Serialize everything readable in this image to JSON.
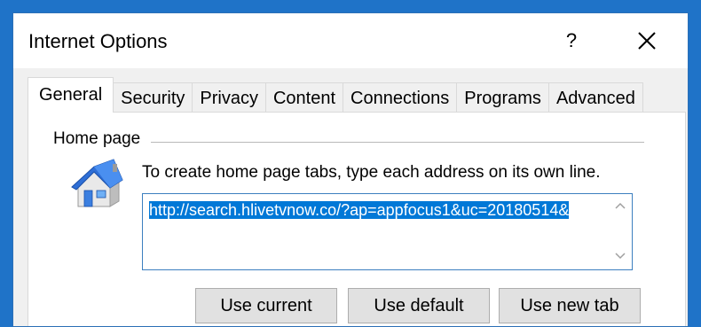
{
  "window": {
    "title": "Internet Options",
    "help_label": "?"
  },
  "tabs": [
    {
      "label": "General",
      "active": true
    },
    {
      "label": "Security",
      "active": false
    },
    {
      "label": "Privacy",
      "active": false
    },
    {
      "label": "Content",
      "active": false
    },
    {
      "label": "Connections",
      "active": false
    },
    {
      "label": "Programs",
      "active": false
    },
    {
      "label": "Advanced",
      "active": false
    }
  ],
  "home_page": {
    "group_label": "Home page",
    "icon": "house-icon",
    "instruction": "To create home page tabs, type each address on its own line.",
    "url_value": "http://search.hlivetvnow.co/?ap=appfocus1&uc=20180514&",
    "buttons": {
      "use_current": "Use current",
      "use_default": "Use default",
      "use_new_tab": "Use new tab"
    }
  },
  "colors": {
    "accent": "#0078d7",
    "window_border": "#2b6fb6",
    "background": "#1f73c8"
  }
}
